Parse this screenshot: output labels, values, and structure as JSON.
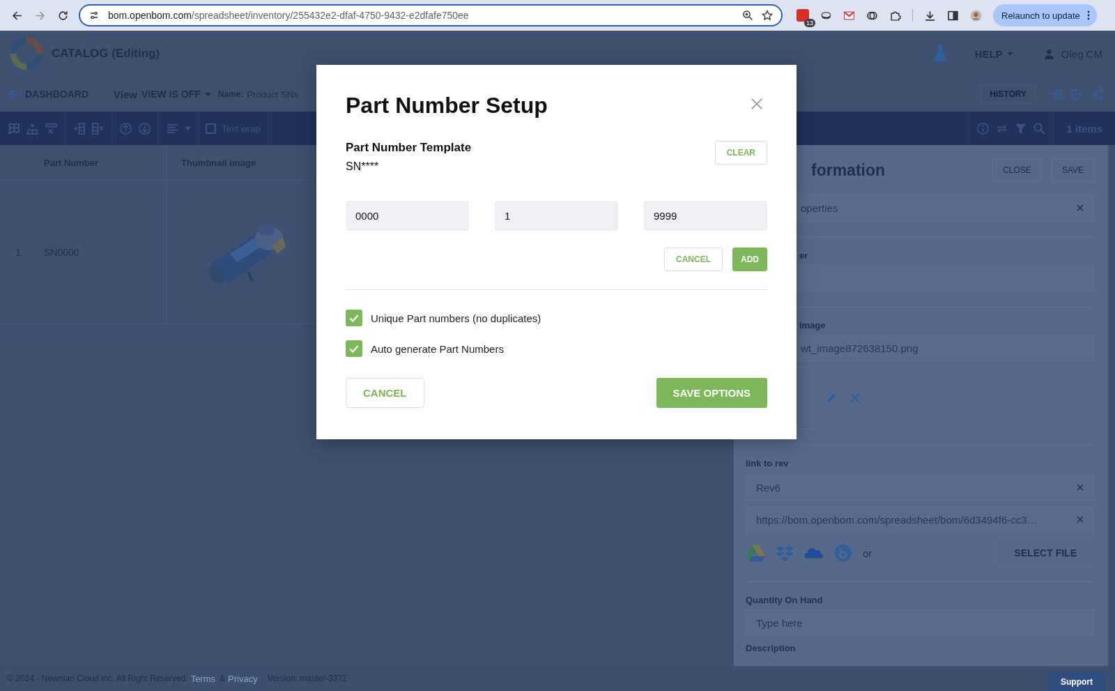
{
  "browser": {
    "url_domain": "bom.openbom.com",
    "url_path": "/spreadsheet/inventory/255432e2-dfaf-4750-9432-e2dfafe750ee",
    "calendar_badge": "13",
    "relaunch_button": "Relaunch to update"
  },
  "app_header": {
    "title": "CATALOG (Editing)",
    "help": "HELP",
    "user": "Oleg CM"
  },
  "subheader": {
    "back": "DASHBOARD",
    "view_label": "View",
    "view_value": "VIEW IS OFF",
    "name_label": "Name:",
    "name_value": "Product SNs",
    "history": "HISTORY"
  },
  "toolbar": {
    "text_wrap": {
      "label": "Text wrap",
      "checked": false
    },
    "count": "1 items"
  },
  "table": {
    "columns": [
      "Part Number",
      "Thumbnail image"
    ],
    "rows": [
      {
        "index": "1",
        "part_number": "SN0000"
      }
    ]
  },
  "side_panel": {
    "title": "formation",
    "close": "CLOSE",
    "save": "SAVE",
    "search_value": "operties",
    "part_label": "er",
    "image_label": "image",
    "image_file": "wt_image872638150.png",
    "link_label": "link to rev",
    "links": [
      "Rev6",
      "https://bom.openbom.com/spreadsheet/bom/6d3494f6-cc3…"
    ],
    "or": "or",
    "select_file": "SELECT FILE",
    "quantity_label": "Quantity On Hand",
    "quantity_placeholder": "Type here",
    "description_label": "Description"
  },
  "modal": {
    "title": "Part Number Setup",
    "template_label": "Part Number Template",
    "template_value": "SN****",
    "clear": "CLEAR",
    "inputs": [
      "0000",
      "1",
      "9999"
    ],
    "cancel_small": "CANCEL",
    "add": "ADD",
    "options": [
      {
        "label": "Unique Part numbers (no duplicates)",
        "checked": true
      },
      {
        "label": "Auto generate Part Numbers",
        "checked": true
      }
    ],
    "cancel": "CANCEL",
    "save": "SAVE OPTIONS"
  },
  "footer": {
    "copyright": "© 2024 - Newman Cloud Inc. All Right Reserved.",
    "terms": "Terms",
    "amp": "&",
    "privacy": "Privacy",
    "version": "Version: master-3372",
    "support": "Support"
  }
}
